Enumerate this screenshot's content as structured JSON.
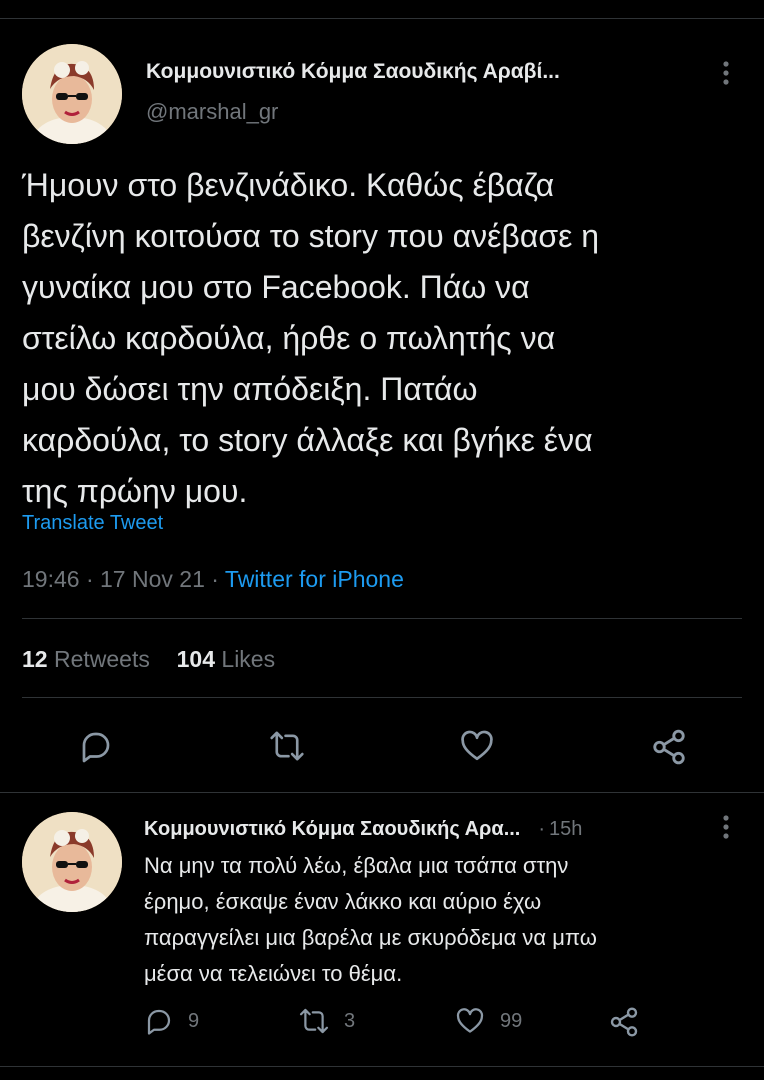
{
  "colors": {
    "background": "#000000",
    "text": "#e7e9ea",
    "muted": "#71767b",
    "link": "#1d9bf0",
    "divider": "#2f3336"
  },
  "main_tweet": {
    "author_name": "Κομμουνιστικό Κόμμα Σαουδικής Αραβί...",
    "handle": "@marshal_gr",
    "body_lines": [
      "Ήμουν στο βενζινάδικο. Καθώς έβαζα",
      "βενζίνη κοιτούσα το story που ανέβασε η",
      "γυναίκα μου στο Facebook. Πάω να",
      "στείλω καρδούλα, ήρθε ο πωλητής να",
      "μου δώσει την απόδειξη. Πατάω",
      "καρδούλα, το story άλλαξε και βγήκε ένα",
      "της πρώην μου."
    ],
    "translate_label": "Translate Tweet",
    "time": "19:46",
    "date": "17 Nov 21",
    "source": "Twitter for iPhone",
    "sep": "·",
    "retweets_count": "12",
    "retweets_label": "Retweets",
    "likes_count": "104",
    "likes_label": "Likes",
    "icons": [
      "more-icon",
      "reply-icon",
      "retweet-icon",
      "like-icon",
      "share-icon"
    ]
  },
  "reply_tweet": {
    "author_name": "Κομμουνιστικό Κόμμα Σαουδικής Αρα...",
    "sep": "·",
    "time": "15h",
    "body_lines": [
      "Να μην τα πολύ λέω, έβαλα μια τσάπα στην",
      "έρημο, έσκαψε έναν λάκκο και αύριο έχω",
      "παραγγείλει μια βαρέλα με σκυρόδεμα να μπω",
      "μέσα να τελειώνει το θέμα."
    ],
    "reply_count": "9",
    "retweet_count": "3",
    "like_count": "99"
  }
}
